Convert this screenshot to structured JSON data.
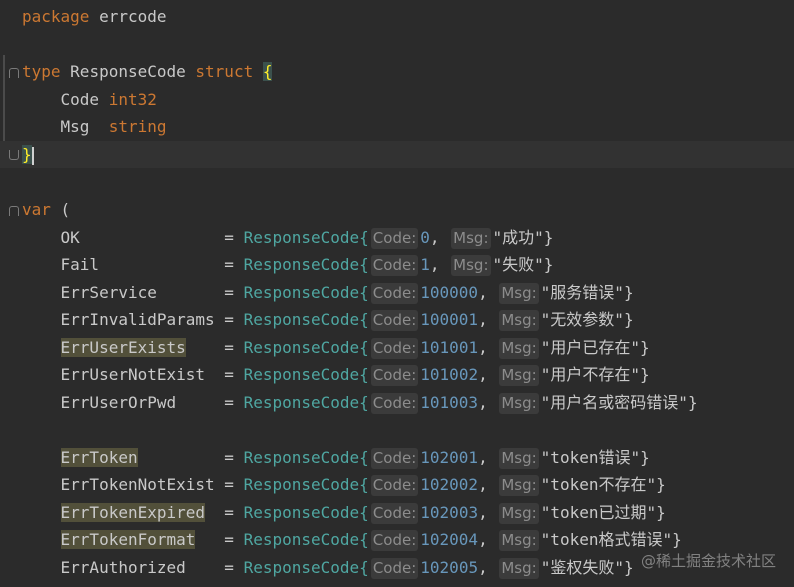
{
  "lines": [
    {
      "id": "pkg",
      "kw": "package",
      "name": "errcode"
    },
    {
      "id": "type",
      "kw": "type",
      "name": "ResponseCode",
      "kw2": "struct",
      "open": "{"
    },
    {
      "id": "field-code",
      "name": "Code",
      "type": "int32"
    },
    {
      "id": "field-msg",
      "name": "Msg",
      "type": "string"
    },
    {
      "id": "close",
      "text": "}"
    },
    {
      "id": "var",
      "kw": "var",
      "open": "("
    }
  ],
  "entries": [
    {
      "name": "OK",
      "pad": "              ",
      "struct": "ResponseCode{",
      "code_hint": "Code:",
      "code": "0",
      "msg_hint": "Msg:",
      "msg": "\"成功\"",
      "close": "}",
      "highlight": false
    },
    {
      "name": "Fail",
      "pad": "            ",
      "struct": "ResponseCode{",
      "code_hint": "Code:",
      "code": "1",
      "msg_hint": "Msg:",
      "msg": "\"失败\"",
      "close": "}",
      "highlight": false
    },
    {
      "name": "ErrService",
      "pad": "      ",
      "struct": "ResponseCode{",
      "code_hint": "Code:",
      "code": "100000",
      "msg_hint": "Msg:",
      "msg": "\"服务错误\"",
      "close": "}",
      "highlight": false
    },
    {
      "name": "ErrInvalidParams",
      "pad": "",
      "struct": "ResponseCode{",
      "code_hint": "Code:",
      "code": "100001",
      "msg_hint": "Msg:",
      "msg": "\"无效参数\"",
      "close": "}",
      "highlight": false
    },
    {
      "name": "ErrUserExists",
      "pad": "   ",
      "struct": "ResponseCode{",
      "code_hint": "Code:",
      "code": "101001",
      "msg_hint": "Msg:",
      "msg": "\"用户已存在\"",
      "close": "}",
      "highlight": true
    },
    {
      "name": "ErrUserNotExist",
      "pad": " ",
      "struct": "ResponseCode{",
      "code_hint": "Code:",
      "code": "101002",
      "msg_hint": "Msg:",
      "msg": "\"用户不存在\"",
      "close": "}",
      "highlight": false
    },
    {
      "name": "ErrUserOrPwd",
      "pad": "    ",
      "struct": "ResponseCode{",
      "code_hint": "Code:",
      "code": "101003",
      "msg_hint": "Msg:",
      "msg": "\"用户名或密码错误\"",
      "close": "}",
      "highlight": false
    },
    {
      "name": "ErrToken",
      "pad": "        ",
      "struct": "ResponseCode{",
      "code_hint": "Code:",
      "code": "102001",
      "msg_hint": "Msg:",
      "msg": "\"token错误\"",
      "close": "}",
      "highlight": true
    },
    {
      "name": "ErrTokenNotExist",
      "pad": "",
      "struct": "ResponseCode{",
      "code_hint": "Code:",
      "code": "102002",
      "msg_hint": "Msg:",
      "msg": "\"token不存在\"",
      "close": "}",
      "highlight": false
    },
    {
      "name": "ErrTokenExpired",
      "pad": " ",
      "struct": "ResponseCode{",
      "code_hint": "Code:",
      "code": "102003",
      "msg_hint": "Msg:",
      "msg": "\"token已过期\"",
      "close": "}",
      "highlight": true
    },
    {
      "name": "ErrTokenFormat",
      "pad": "  ",
      "struct": "ResponseCode{",
      "code_hint": "Code:",
      "code": "102004",
      "msg_hint": "Msg:",
      "msg": "\"token格式错误\"",
      "close": "}",
      "highlight": true
    },
    {
      "name": "ErrAuthorized",
      "pad": "   ",
      "struct": "ResponseCode{",
      "code_hint": "Code:",
      "code": "102005",
      "msg_hint": "Msg:",
      "msg": "\"鉴权失败\"",
      "close": "}",
      "highlight": false
    }
  ],
  "watermark": "@稀土掘金技术社区",
  "colors": {
    "background": "#2b2b2b",
    "keyword": "#cc7832",
    "struct_name": "#4fa7a2",
    "number": "#6897bb",
    "string": "#c9c9c9",
    "identifier_highlight": "#52503a"
  }
}
